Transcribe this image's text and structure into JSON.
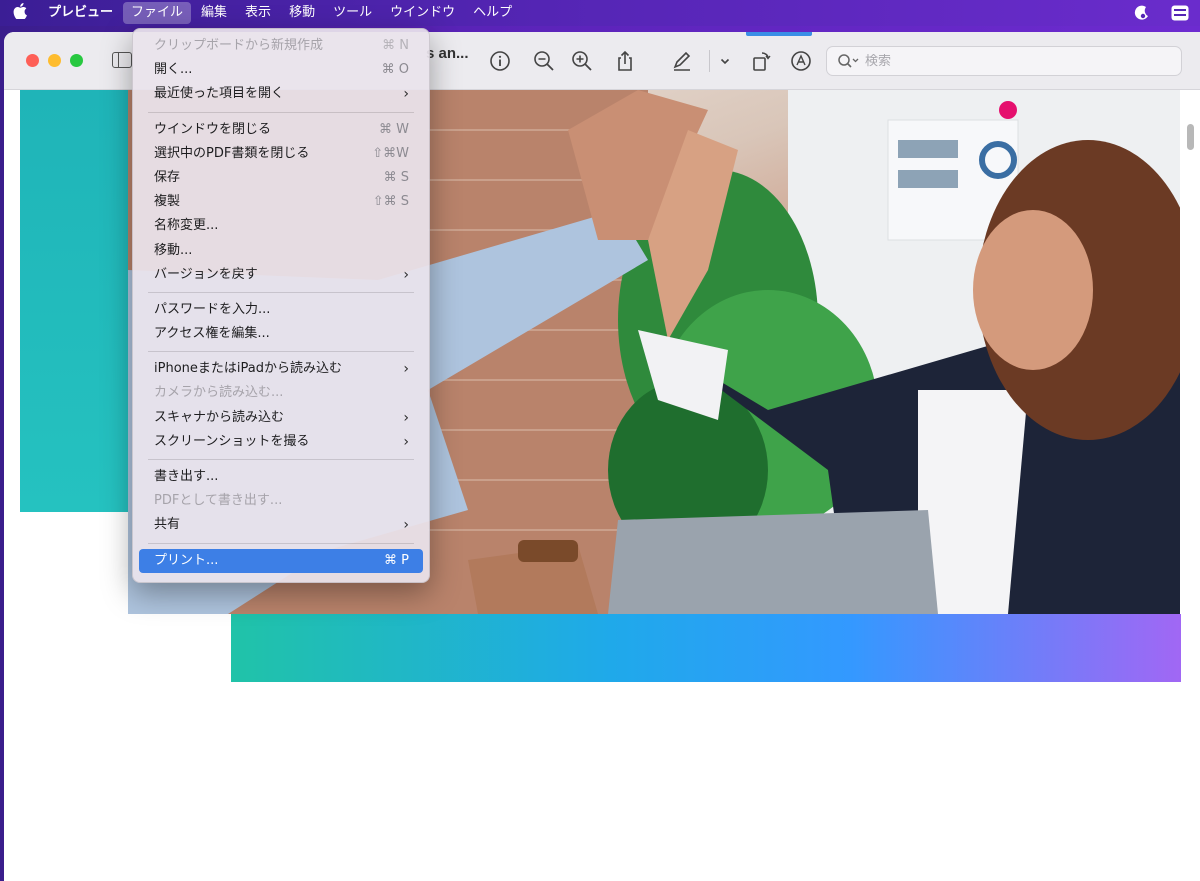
{
  "menubar": {
    "items": [
      "プレビュー",
      "ファイル",
      "編集",
      "表示",
      "移動",
      "ツール",
      "ウインドウ",
      "ヘルプ"
    ],
    "active_index": 1
  },
  "toolbar": {
    "doc_title": "s an...",
    "search_placeholder": "検索"
  },
  "file_menu": {
    "groups": [
      [
        {
          "label": "クリップボードから新規作成",
          "shortcut": "⌘ N",
          "disabled": true
        },
        {
          "label": "開く...",
          "shortcut": "⌘ O"
        },
        {
          "label": "最近使った項目を開く",
          "submenu": true
        }
      ],
      [
        {
          "label": "ウインドウを閉じる",
          "shortcut": "⌘ W"
        },
        {
          "label": "選択中のPDF書類を閉じる",
          "shortcut": "⇧⌘W"
        },
        {
          "label": "保存",
          "shortcut": "⌘ S"
        },
        {
          "label": "複製",
          "shortcut": "⇧⌘ S"
        },
        {
          "label": "名称変更..."
        },
        {
          "label": "移動..."
        },
        {
          "label": "バージョンを戻す",
          "submenu": true
        }
      ],
      [
        {
          "label": "パスワードを入力..."
        },
        {
          "label": "アクセス権を編集..."
        }
      ],
      [
        {
          "label": "iPhoneまたはiPadから読み込む",
          "submenu": true
        },
        {
          "label": "カメラから読み込む...",
          "disabled": true
        },
        {
          "label": "スキャナから読み込む",
          "submenu": true
        },
        {
          "label": "スクリーンショットを撮る",
          "submenu": true
        }
      ],
      [
        {
          "label": "書き出す..."
        },
        {
          "label": "PDFとして書き出す...",
          "disabled": true
        },
        {
          "label": "共有",
          "submenu": true
        }
      ],
      [
        {
          "label": "プリント...",
          "shortcut": "⌘ P",
          "highlighted": true
        }
      ]
    ]
  },
  "colors": {
    "menubar_bg": "#5425b4",
    "highlight": "#3d7fe6",
    "teal_block": "#1fb4b8",
    "gradient_bar_start": "#20c3a8",
    "gradient_bar_end": "#a167f4"
  }
}
